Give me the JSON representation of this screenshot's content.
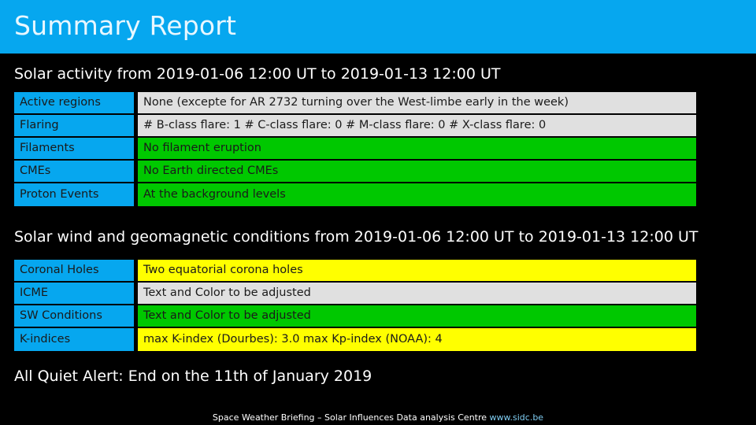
{
  "header": {
    "title": "Summary Report",
    "band_color": "#06a7ef"
  },
  "solar_activity": {
    "heading": "Solar activity from 2019-01-06 12:00 UT to 2019-01-13 12:00 UT",
    "rows": [
      {
        "label": "Active regions",
        "value": "None (excepte for AR 2732 turning over the West-limbe early in the week)",
        "status_color": "#e0e0e0"
      },
      {
        "label": "Flaring",
        "value": "# B-class flare: 1   # C-class flare: 0   # M-class flare: 0   # X-class flare: 0",
        "status_color": "#e0e0e0"
      },
      {
        "label": "Filaments",
        "value": "No filament eruption",
        "status_color": "#00c800"
      },
      {
        "label": "CMEs",
        "value": "No Earth directed CMEs",
        "status_color": "#00c800"
      },
      {
        "label": "Proton Events",
        "value": "At the background levels",
        "status_color": "#00c800"
      }
    ]
  },
  "solar_wind": {
    "heading": "Solar wind and geomagnetic conditions from 2019-01-06 12:00 UT to 2019-01-13 12:00 UT",
    "rows": [
      {
        "label": "Coronal Holes",
        "value": "Two equatorial corona holes",
        "status_color": "#ffff00"
      },
      {
        "label": "ICME",
        "value": "Text and Color to be adjusted",
        "status_color": "#e0e0e0"
      },
      {
        "label": "SW Conditions",
        "value": "Text and Color to be adjusted",
        "status_color": "#00c800"
      },
      {
        "label": "K-indices",
        "value": "max K-index (Dourbes): 3.0   max Kp-index (NOAA): 4",
        "status_color": "#ffff00"
      }
    ]
  },
  "alert": {
    "text": "All Quiet Alert: End on the 11th of January 2019"
  },
  "footer": {
    "text": "Space Weather Briefing – Solar Influences Data analysis Centre",
    "url": "www.sidc.be",
    "url_color": "#7ecbf0"
  }
}
